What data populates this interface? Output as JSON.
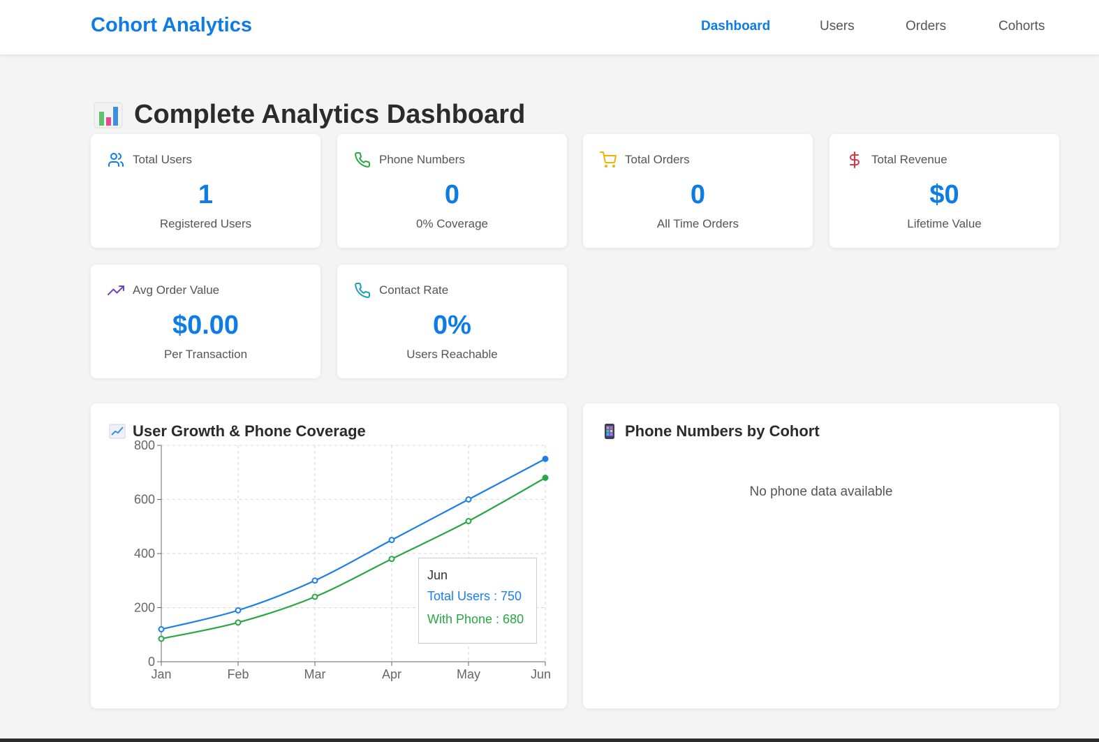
{
  "nav": {
    "brand": "Cohort Analytics",
    "items": [
      {
        "label": "Dashboard",
        "active": true
      },
      {
        "label": "Users",
        "active": false
      },
      {
        "label": "Orders",
        "active": false
      },
      {
        "label": "Cohorts",
        "active": false
      }
    ]
  },
  "page": {
    "title": "Complete Analytics Dashboard",
    "title_icon": "bar-chart-emoji-icon"
  },
  "stats": [
    {
      "icon": "users-icon",
      "label": "Total Users",
      "value": "1",
      "sub": "Registered Users",
      "icon_color": "#0d7be8"
    },
    {
      "icon": "phone-icon",
      "label": "Phone Numbers",
      "value": "0",
      "sub": "0% Coverage",
      "icon_color": "#28a745"
    },
    {
      "icon": "cart-icon",
      "label": "Total Orders",
      "value": "0",
      "sub": "All Time Orders",
      "icon_color": "#f0b400"
    },
    {
      "icon": "dollar-icon",
      "label": "Total Revenue",
      "value": "$0",
      "sub": "Lifetime Value",
      "icon_color": "#dc3545"
    },
    {
      "icon": "trending-up-icon",
      "label": "Avg Order Value",
      "value": "$0.00",
      "sub": "Per Transaction",
      "icon_color": "#6f42c1"
    },
    {
      "icon": "phone-icon",
      "label": "Contact Rate",
      "value": "0%",
      "sub": "Users Reachable",
      "icon_color": "#17a2b8"
    }
  ],
  "growth_panel": {
    "title": "User Growth & Phone Coverage",
    "icon": "chart-increasing-emoji-icon",
    "tooltip": {
      "title": "Jun",
      "rows": [
        "Total Users : 750",
        "With Phone : 680"
      ]
    }
  },
  "phone_panel": {
    "title": "Phone Numbers by Cohort",
    "icon": "mobile-phone-emoji-icon",
    "empty_message": "No phone data available"
  },
  "colors": {
    "accent": "#0d7be8",
    "total_users": "#1a7fe6",
    "with_phone": "#28a745"
  },
  "chart_data": {
    "type": "line",
    "categories": [
      "Jan",
      "Feb",
      "Mar",
      "Apr",
      "May",
      "Jun"
    ],
    "series": [
      {
        "name": "Total Users",
        "values": [
          120,
          190,
          300,
          450,
          600,
          750
        ],
        "color": "#1a7fe6"
      },
      {
        "name": "With Phone",
        "values": [
          85,
          145,
          240,
          380,
          520,
          680
        ],
        "color": "#28a745"
      }
    ],
    "yticks": [
      0,
      200,
      400,
      600,
      800
    ],
    "ylim": [
      0,
      800
    ],
    "grid": true,
    "legend": "none",
    "tooltip_category": "Jun"
  }
}
